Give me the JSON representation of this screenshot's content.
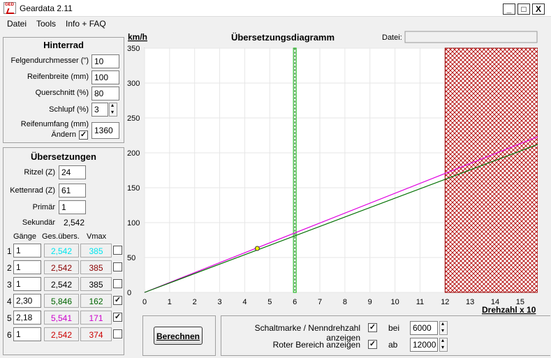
{
  "window": {
    "title": "Geardata 2.11",
    "min": "_",
    "max": "□",
    "close": "X"
  },
  "menu": [
    "Datei",
    "Tools",
    "Info + FAQ"
  ],
  "hinterrad": {
    "title": "Hinterrad",
    "felgen_label": "Felgendurchmesser (\")",
    "felgen_value": "10",
    "breite_label": "Reifenbreite (mm)",
    "breite_value": "100",
    "quer_label": "Querschnitt (%)",
    "quer_value": "80",
    "schlupf_label": "Schlupf (%)",
    "schlupf_value": "3",
    "umfang_label": "Reifenumfang (mm)",
    "umfang_value": "1360",
    "aendern_label": "Ändern",
    "aendern_checked": "✓"
  },
  "uebersetzungen": {
    "title": "Übersetzungen",
    "ritzel_label": "Ritzel (Z)",
    "ritzel_value": "24",
    "kettenrad_label": "Kettenrad (Z)",
    "kettenrad_value": "61",
    "primaer_label": "Primär",
    "primaer_value": "1",
    "sekundaer_label": "Sekundär",
    "sekundaer_value": "2,542",
    "col_gaenge": "Gänge",
    "col_ges": "Ges.übers.",
    "col_vmax": "Vmax",
    "gears": [
      {
        "n": "1",
        "input": "1",
        "ges": "2,542",
        "vmax": "385",
        "color": "#00e5ee",
        "checked": ""
      },
      {
        "n": "2",
        "input": "1",
        "ges": "2,542",
        "vmax": "385",
        "color": "#8b0000",
        "checked": ""
      },
      {
        "n": "3",
        "input": "1",
        "ges": "2,542",
        "vmax": "385",
        "color": "#000000",
        "checked": ""
      },
      {
        "n": "4",
        "input": "2,30",
        "ges": "5,846",
        "vmax": "162",
        "color": "#006400",
        "checked": "✓"
      },
      {
        "n": "5",
        "input": "2,18",
        "ges": "5,541",
        "vmax": "171",
        "color": "#cc00cc",
        "checked": "✓"
      },
      {
        "n": "6",
        "input": "1",
        "ges": "2,542",
        "vmax": "374",
        "color": "#cc0000",
        "checked": ""
      }
    ]
  },
  "diagram": {
    "title": "Übersetzungsdiagramm",
    "datei_label": "Datei:",
    "datei_value": ""
  },
  "bottom": {
    "berechnen_label": "Berechnen",
    "schaltmarke_label": "Schaltmarke / Nenndrehzahl anzeigen",
    "schaltmarke_checked": "✓",
    "bei_label": "bei",
    "bei_value": "6000",
    "rot_label": "Roter Bereich anzeigen",
    "rot_checked": "✓",
    "ab_label": "ab",
    "ab_value": "12000"
  },
  "chart_data": {
    "type": "line",
    "ylabel": "km/h",
    "xlabel": "Drehzahl x 10",
    "xlim": [
      0,
      15.7
    ],
    "ylim": [
      0,
      350
    ],
    "xticks": [
      "0",
      "1",
      "2",
      "3",
      "4",
      "5",
      "6",
      "7",
      "8",
      "9",
      "10",
      "11",
      "12",
      "13",
      "14",
      "15"
    ],
    "yticks": [
      "0",
      "50",
      "100",
      "150",
      "200",
      "250",
      "300",
      "350"
    ],
    "series": [
      {
        "color": "#e000e0",
        "x": [
          0,
          15.7
        ],
        "y": [
          0,
          223
        ]
      },
      {
        "color": "#007000",
        "x": [
          0,
          15.7
        ],
        "y": [
          0,
          212
        ]
      }
    ],
    "marker_x": 6,
    "red_zone_from": 12,
    "point": {
      "x": 4.5,
      "y": 63
    }
  }
}
